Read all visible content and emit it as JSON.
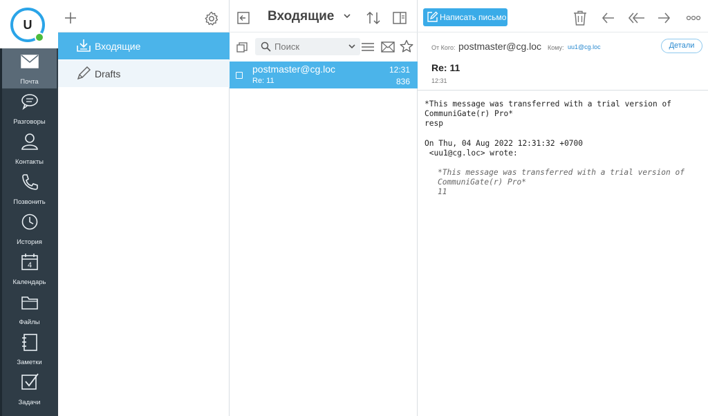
{
  "user": {
    "avatar_initial": "U"
  },
  "rail": {
    "items": [
      {
        "label": "Почта",
        "icon": "mail-icon"
      },
      {
        "label": "Разговоры",
        "icon": "chat-icon"
      },
      {
        "label": "Контакты",
        "icon": "contact-icon"
      },
      {
        "label": "Позвонить",
        "icon": "phone-icon"
      },
      {
        "label": "История",
        "icon": "clock-icon"
      },
      {
        "label": "Календарь",
        "icon": "calendar-icon",
        "badge": "4"
      },
      {
        "label": "Файлы",
        "icon": "folder-icon"
      },
      {
        "label": "Заметки",
        "icon": "notes-icon"
      },
      {
        "label": "Задачи",
        "icon": "tasks-icon"
      }
    ]
  },
  "folders": {
    "items": [
      {
        "label": "Входящие",
        "icon": "inbox-icon"
      },
      {
        "label": "Drafts",
        "icon": "pencil-icon"
      }
    ]
  },
  "list": {
    "title": "Входящие",
    "search_placeholder": "Поиск",
    "messages": [
      {
        "from": "postmaster@cg.loc",
        "time": "12:31",
        "subject": "Re: 11",
        "size": "836"
      }
    ]
  },
  "reader": {
    "compose_label": "Написать письмо",
    "from_label": "От Кого:",
    "from": "postmaster@cg.loc",
    "to_label": "Кому:",
    "to": "uu1@cg.loc",
    "details_label": "Детали",
    "subject": "Re: 11",
    "time": "12:31",
    "body": "*This message was transferred with a trial version of\nCommuniGate(r) Pro*\nresp\n\nOn Thu, 04 Aug 2022 12:31:32 +0700\n <uu1@cg.loc> wrote:",
    "quote": "*This message was transferred with a trial version of\nCommuniGate(r) Pro*\n11"
  },
  "colors": {
    "accent": "#4bb4ea",
    "rail": "#2f3c46",
    "rail_active": "#5a6a77",
    "presence": "#4cbb3c"
  }
}
